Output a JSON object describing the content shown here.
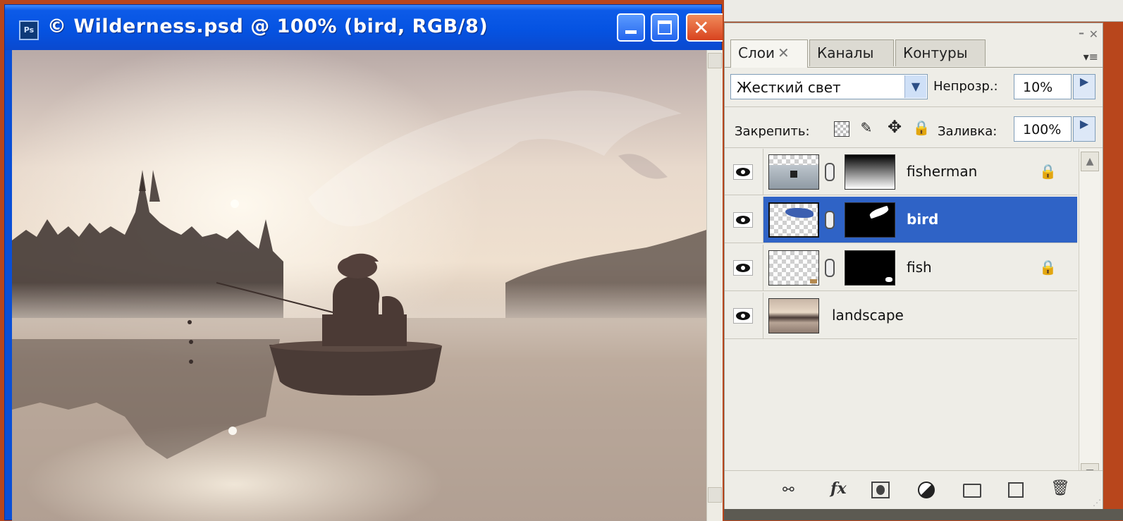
{
  "window": {
    "title": "© Wilderness.psd @ 100% (bird, RGB/8)",
    "app_icon_label": "Ps",
    "close_glyph": "✕",
    "icon": "photoshop-document-icon"
  },
  "layers_panel": {
    "tabs": [
      {
        "label": "Слои",
        "active": true
      },
      {
        "label": "Каналы",
        "active": false
      },
      {
        "label": "Контуры",
        "active": false
      }
    ],
    "tab_close_glyph": "✕",
    "blend_mode": "Жесткий свет",
    "opacity_label": "Непрозр.:",
    "opacity_value": "10%",
    "lock_label": "Закрепить:",
    "fill_label": "Заливка:",
    "fill_value": "100%",
    "layers": [
      {
        "name": "fisherman",
        "has_mask": true,
        "locked": true,
        "selected": false,
        "visible": true
      },
      {
        "name": "bird",
        "has_mask": true,
        "locked": false,
        "selected": true,
        "visible": true
      },
      {
        "name": "fish",
        "has_mask": true,
        "locked": true,
        "selected": false,
        "visible": true
      },
      {
        "name": "landscape",
        "has_mask": false,
        "locked": false,
        "selected": false,
        "visible": true
      }
    ],
    "lock_glyph": "🔒",
    "bottom_tools": [
      "link-layers",
      "layer-style-fx",
      "add-mask",
      "adjustment-layer",
      "new-group",
      "new-layer",
      "delete-layer"
    ],
    "fx_label": "fx"
  },
  "colors": {
    "titlebar": "#0553e2",
    "selection": "#2f63c6",
    "desktop": "#b8461c",
    "panel": "#eeede7"
  }
}
